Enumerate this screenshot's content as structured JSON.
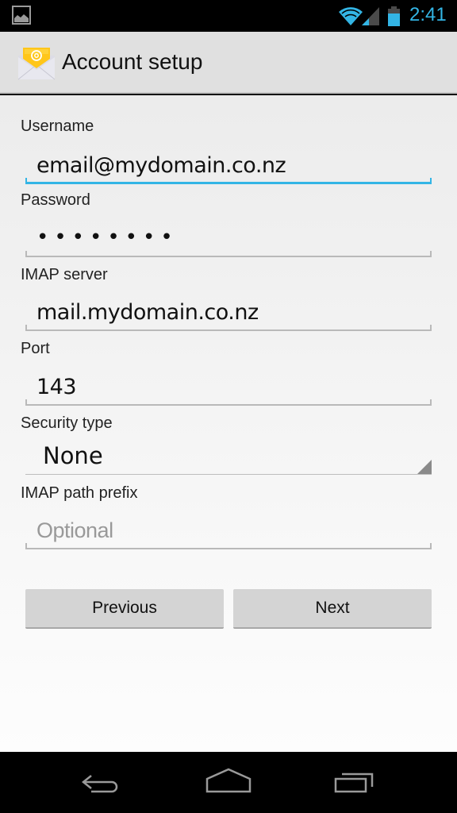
{
  "status_bar": {
    "time": "2:41",
    "icons": [
      "image-notification-icon",
      "wifi-icon",
      "cell-signal-icon",
      "battery-icon"
    ],
    "accent_color": "#33b5e5"
  },
  "action_bar": {
    "title": "Account setup",
    "icon": "email-envelope-icon"
  },
  "form": {
    "username": {
      "label": "Username",
      "value": "email@mydomain.co.nz",
      "focused": true
    },
    "password": {
      "label": "Password",
      "value": "••••••••"
    },
    "imap_server": {
      "label": "IMAP server",
      "value": "mail.mydomain.co.nz"
    },
    "port": {
      "label": "Port",
      "value": "143"
    },
    "security_type": {
      "label": "Security type",
      "value": "None"
    },
    "imap_path_prefix": {
      "label": "IMAP path prefix",
      "value": "",
      "placeholder": "Optional"
    }
  },
  "buttons": {
    "previous": "Previous",
    "next": "Next"
  },
  "nav_bar": {
    "items": [
      "back-icon",
      "home-icon",
      "recent-apps-icon"
    ]
  }
}
